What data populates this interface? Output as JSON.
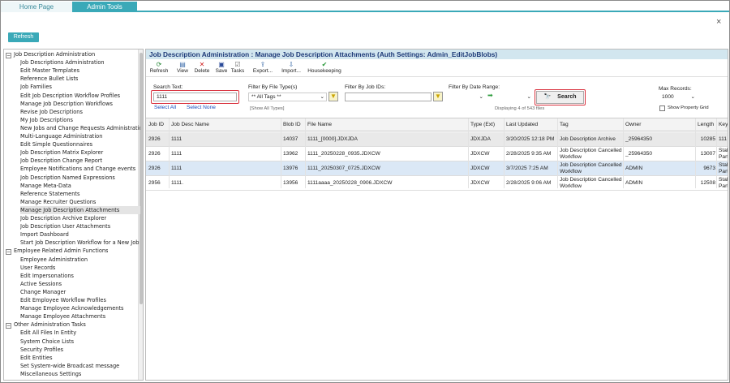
{
  "tabs": [
    {
      "label": "Home Page"
    },
    {
      "label": "Admin Tools"
    }
  ],
  "top": {
    "refresh_label": "Refresh",
    "close_glyph": "×"
  },
  "tree": {
    "groups": [
      {
        "label": "Job Description Administration",
        "toggle": "−",
        "items": [
          "Job Descriptions Administration",
          "Edit Master Templates",
          "Reference Bullet Lists",
          "Job Families",
          "Edit Job Description Workflow Profiles",
          "Manage Job Description Workflows",
          "Revise Job Descriptions",
          "My Job Descriptions",
          "New Jobs and Change Requests Administration",
          "Multi-Language Administration",
          "Edit Simple Questionnaires",
          "Job Description Matrix Explorer",
          "Job Description Change Report",
          "Employee Notifications and Change events",
          "Job Description Named Expressions",
          "Manage Meta-Data",
          "Reference Statements",
          "Manage Recruiter Questions",
          "Manage Job Description Attachments",
          "Job Description Archive Explorer",
          "Job Description User Attachments",
          "Import Dashboard",
          "Start Job Description Workflow for a New Job"
        ]
      },
      {
        "label": "Employee Related Admin Functions",
        "toggle": "−",
        "items": [
          "Employee Administration",
          "User Records",
          "Edit Impersonations",
          "Active Sessions",
          "Change Manager",
          "Edit Employee Workflow Profiles",
          "Manage Employee Acknowledgements",
          "Manage Employee Attachments"
        ]
      },
      {
        "label": "Other Administration Tasks",
        "toggle": "−",
        "items": [
          "Edit All Files In Entity",
          "System Choice Lists",
          "Security Profiles",
          "Edit Entities",
          "Set System-wide Broadcast message",
          "Miscellaneous Settings"
        ]
      }
    ],
    "selected": "Manage Job Description Attachments"
  },
  "main": {
    "title": "Job Description Administration : Manage Job Description Attachments (Auth Settings: Admin_EditJobBlobs)",
    "toolbar": [
      {
        "label": "Refresh",
        "icon": "refresh-icon",
        "glyph": "⟳",
        "color": "#2a8a3a"
      },
      {
        "label": "View",
        "icon": "view-icon",
        "glyph": "▤",
        "color": "#3a6aa8"
      },
      {
        "label": "Delete",
        "icon": "delete-icon",
        "glyph": "✕",
        "color": "#d02020"
      },
      {
        "label": "Save",
        "icon": "save-icon",
        "glyph": "▣",
        "color": "#2a4a98"
      },
      {
        "label": "Tasks",
        "icon": "tasks-icon",
        "glyph": "☑",
        "color": "#6a6a6a"
      },
      {
        "label": "Export...",
        "icon": "export-icon",
        "glyph": "⇪",
        "color": "#3a6aa8"
      },
      {
        "label": "Import...",
        "icon": "import-icon",
        "glyph": "⇩",
        "color": "#3a6aa8"
      },
      {
        "label": "Housekeeping",
        "icon": "housekeeping-icon",
        "glyph": "✔",
        "color": "#2a9a3a"
      }
    ],
    "filters": {
      "search_text_label": "Search Text:",
      "search_text_value": "1111",
      "select_all": "Select All",
      "select_none": "Select None",
      "file_type_label": "Filter By File Type(s)",
      "file_type_value": "** All Tags **",
      "file_type_hint": "[Show All Types]",
      "job_ids_label": "Filter By Job IDs:",
      "job_ids_value": "",
      "date_range_label": "Filter By Date Range:",
      "date_from": "",
      "date_to": "",
      "displaying": "Displaying 4 of 543 files",
      "search_label": "Search",
      "max_records_label": "Max Records:",
      "max_records_value": "1000",
      "show_property_grid": "Show Property Grid"
    },
    "grid": {
      "columns": [
        "Job ID",
        "Job Desc Name",
        "Blob ID",
        "File Name",
        "Type (Ext)",
        "Last Updated",
        "Tag",
        "Owner",
        "Length",
        "Key"
      ],
      "rows": [
        [
          "2926",
          "1111",
          "14037",
          "1111_[0000].JDXJDA",
          "JDXJDA",
          "3/20/2025 12:18 PM",
          "Job Description Archive",
          "_25964350",
          "10285",
          "111"
        ],
        [
          "2926",
          "1111",
          "13962",
          "1111_20250228_0935.JDXCW",
          "JDXCW",
          "2/28/2025 9:35 AM",
          "Job Description Cancelled Workflow",
          "_25964350",
          "13007",
          "Stal Part"
        ],
        [
          "2926",
          "1111",
          "13976",
          "1111_20250307_0725.JDXCW",
          "JDXCW",
          "3/7/2025 7:25 AM",
          "Job Description Cancelled Workflow",
          "ADMIN",
          "9673",
          "Stal Part"
        ],
        [
          "2956",
          "1111.",
          "13956",
          "1111aaaa_20250228_0906.JDXCW",
          "JDXCW",
          "2/28/2025 9:06 AM",
          "Job Description Cancelled Workflow",
          "ADMIN",
          "12508",
          "Stal Part"
        ]
      ]
    }
  },
  "colors": {
    "accent": "#3aa9b8",
    "title_bg": "#d2e6ef",
    "title_fg": "#1e3a78",
    "highlight": "#d9333f",
    "selected_row": "#dbe8f6"
  }
}
